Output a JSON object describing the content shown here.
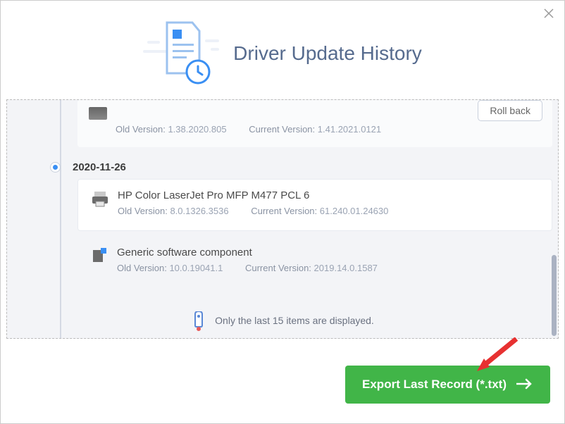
{
  "header": {
    "title": "Driver Update History"
  },
  "partialEntry": {
    "oldLabel": "Old Version:",
    "oldVal": "1.38.2020.805",
    "curLabel": "Current Version:",
    "curVal": "1.41.2021.0121",
    "rollbackLabel": "Roll back"
  },
  "dateGroup": {
    "date": "2020-11-26"
  },
  "devices": [
    {
      "name": "HP Color LaserJet Pro MFP M477 PCL 6",
      "oldLabel": "Old Version:",
      "oldVal": "8.0.1326.3536",
      "curLabel": "Current Version:",
      "curVal": "61.240.01.24630"
    },
    {
      "name": "Generic software component",
      "oldLabel": "Old Version:",
      "oldVal": "10.0.19041.1",
      "curLabel": "Current Version:",
      "curVal": "2019.14.0.1587"
    }
  ],
  "notice": "Only the last 15 items are displayed.",
  "exportLabel": "Export Last Record (*.txt)"
}
